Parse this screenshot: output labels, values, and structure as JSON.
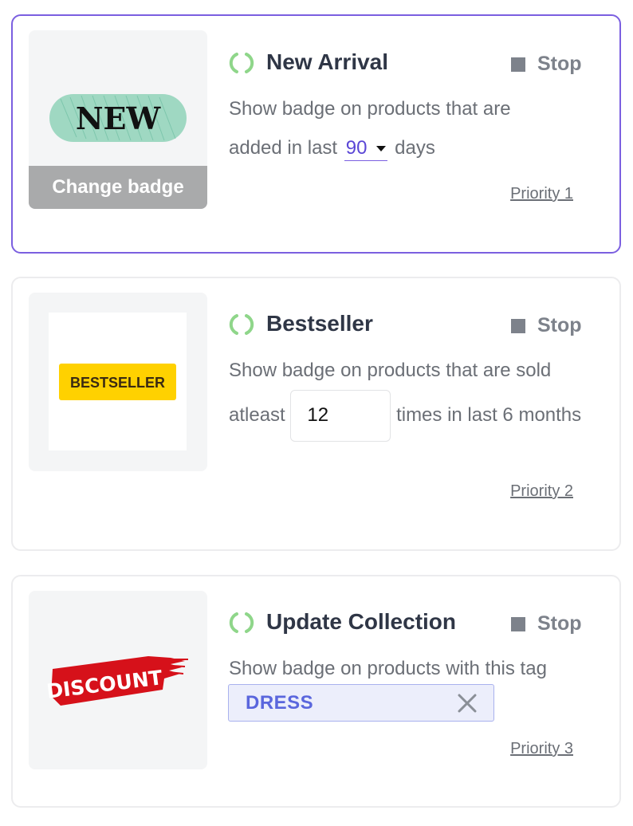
{
  "rules": [
    {
      "title": "New Arrival",
      "stop_label": "Stop",
      "badge_text": "NEW",
      "change_badge_label": "Change badge",
      "desc_before": "Show badge on products that are added in last",
      "days_value": "90",
      "desc_after": "days",
      "priority": "Priority 1"
    },
    {
      "title": "Bestseller",
      "stop_label": "Stop",
      "badge_text": "BESTSELLER",
      "desc_before": "Show badge on products that are sold atleast",
      "times_value": "12",
      "desc_after": "times in last 6 months",
      "priority": "Priority 2"
    },
    {
      "title": "Update Collection",
      "stop_label": "Stop",
      "badge_text": "DISCOUNT",
      "desc": "Show badge on products with this tag",
      "tag": "DRESS",
      "priority": "Priority 3"
    }
  ],
  "colors": {
    "accent": "#7b5fe0",
    "spinner": "#8fd68a",
    "title": "#2f3646",
    "new_badge": "#9fd8c2",
    "bestseller_badge": "#ffd100",
    "discount_badge": "#d6111a",
    "tag_bg": "#eceefb",
    "tag_text": "#5a66dd"
  },
  "icons": {
    "status": "loading-spinner-icon",
    "stop": "stop-square-icon",
    "dropdown": "caret-down-icon",
    "remove_tag": "close-x-icon"
  }
}
